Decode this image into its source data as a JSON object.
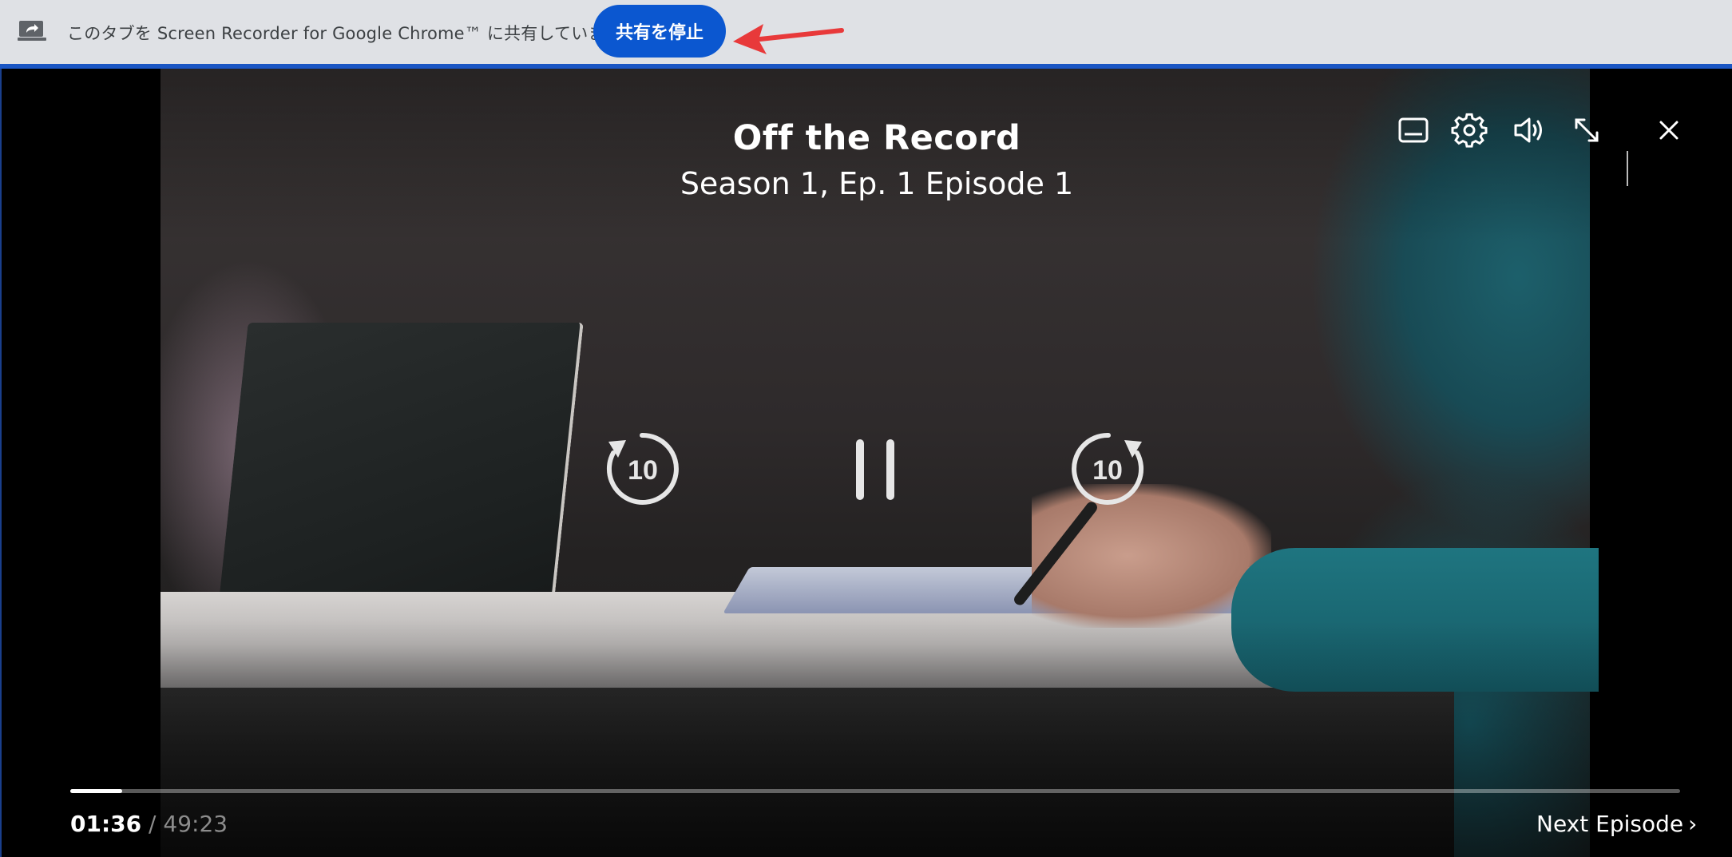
{
  "share_bar": {
    "message": "このタブを Screen Recorder for Google Chrome™ に共有しています",
    "stop_button": "共有を停止",
    "icon": "share-screen-icon",
    "arrow_color": "#e8393a",
    "accent": "#0b57d0"
  },
  "player": {
    "title": "Off the Record",
    "episode": "Season 1, Ep. 1 Episode 1",
    "controls": {
      "subtitles": "subtitles-icon",
      "settings": "gear-icon",
      "volume": "volume-icon",
      "fullscreen": "expand-icon",
      "close": "close-icon"
    },
    "center": {
      "rewind_label": "10",
      "forward_label": "10",
      "play_state": "pause"
    },
    "time": {
      "current": "01:36",
      "separator": " / ",
      "total": "49:23"
    },
    "progress_fraction": 0.032,
    "next_episode": "Next Episode"
  }
}
